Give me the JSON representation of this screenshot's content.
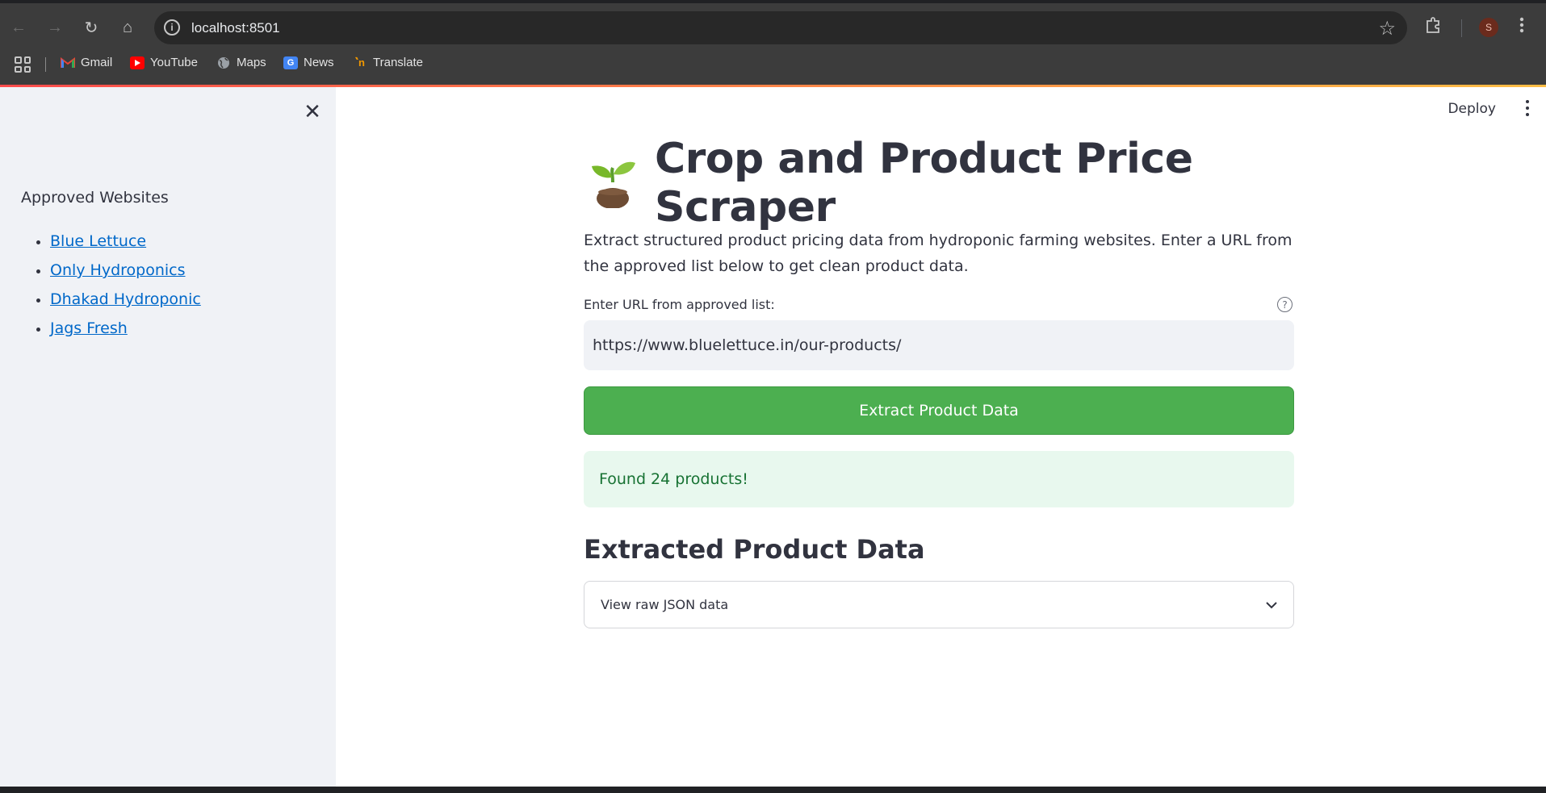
{
  "browser": {
    "url": "localhost:8501",
    "bookmarks": [
      {
        "label": "Gmail"
      },
      {
        "label": "YouTube"
      },
      {
        "label": "Maps"
      },
      {
        "label": "News"
      },
      {
        "label": "Translate"
      }
    ],
    "profile_initial": "S"
  },
  "sidebar": {
    "heading": "Approved Websites",
    "links": [
      {
        "label": "Blue Lettuce"
      },
      {
        "label": "Only Hydroponics"
      },
      {
        "label": "Dhakad Hydroponic"
      },
      {
        "label": "Jags Fresh"
      }
    ]
  },
  "header": {
    "deploy_label": "Deploy"
  },
  "main": {
    "title": "Crop and Product Price Scraper",
    "description": "Extract structured product pricing data from hydroponic farming websites. Enter a URL from the approved list below to get clean product data.",
    "url_field": {
      "label": "Enter URL from approved list:",
      "value": "https://www.bluelettuce.in/our-products/"
    },
    "extract_button": "Extract Product Data",
    "success_message": "Found 24 products!",
    "section_title": "Extracted Product Data",
    "expander_label": "View raw JSON data"
  },
  "colors": {
    "primary_button": "#4caf50",
    "link": "#0068c9",
    "success_bg": "#e8f8ee",
    "success_text": "#177233",
    "sidebar_bg": "#f0f2f6"
  }
}
